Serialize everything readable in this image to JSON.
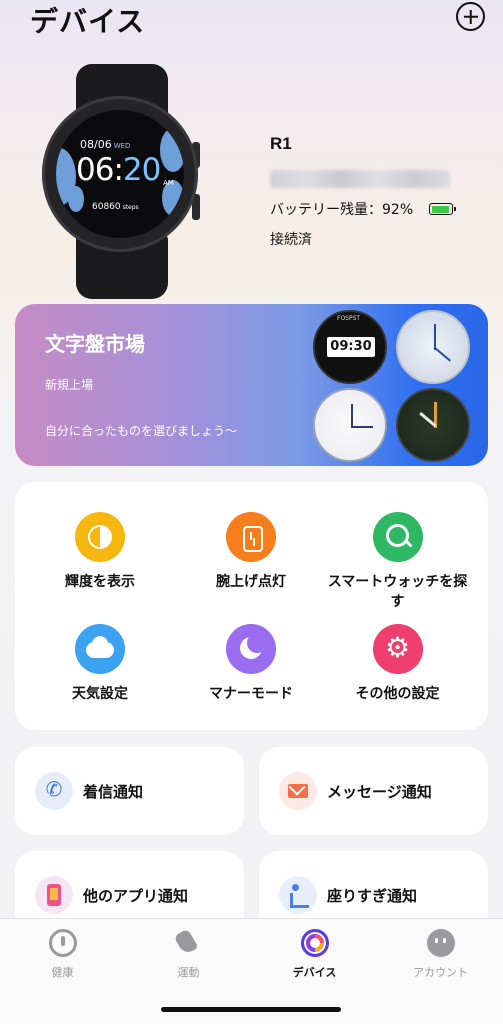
{
  "header": {
    "title": "デバイス",
    "add_icon": "plus-circle-icon"
  },
  "device": {
    "watch_face": {
      "date": "08/06",
      "weekday": "WED",
      "hour": "06",
      "minute": "20",
      "ampm": "AM",
      "steps": "60860",
      "steps_unit": "steps"
    },
    "name": "R1",
    "battery_label": "バッテリー残量：92%",
    "battery_percent": 92,
    "status": "接続済"
  },
  "banner": {
    "title": "文字盤市場",
    "subtitle": "新規上場",
    "description": "自分に合ったものを選びましょう～",
    "faces": [
      {
        "brand": "FOSPST",
        "time": "09:30"
      },
      {
        "label": ""
      },
      {
        "label": ""
      },
      {
        "label": ""
      }
    ]
  },
  "functions": [
    {
      "label": "輝度を表示",
      "icon": "brightness-icon",
      "color": "#f5b70f"
    },
    {
      "label": "腕上げ点灯",
      "icon": "wrist-raise-icon",
      "color": "#f77e1c"
    },
    {
      "label": "スマートウォッチを探す",
      "icon": "search-icon",
      "color": "#2fb864"
    },
    {
      "label": "天気設定",
      "icon": "cloud-icon",
      "color": "#3aa2f0"
    },
    {
      "label": "マナーモード",
      "icon": "moon-icon",
      "color": "#9a6cf0"
    },
    {
      "label": "その他の設定",
      "icon": "gear-icon",
      "color": "#ee3f6f"
    }
  ],
  "notifications": [
    {
      "label": "着信通知",
      "icon": "phone-icon"
    },
    {
      "label": "メッセージ通知",
      "icon": "mail-icon"
    },
    {
      "label": "他のアプリ通知",
      "icon": "app-icon"
    },
    {
      "label": "座りすぎ通知",
      "icon": "sitting-icon"
    }
  ],
  "tabs": [
    {
      "label": "健康",
      "icon": "health-icon"
    },
    {
      "label": "運動",
      "icon": "shoe-icon"
    },
    {
      "label": "デバイス",
      "icon": "device-icon",
      "active": true
    },
    {
      "label": "アカウント",
      "icon": "account-icon"
    }
  ]
}
